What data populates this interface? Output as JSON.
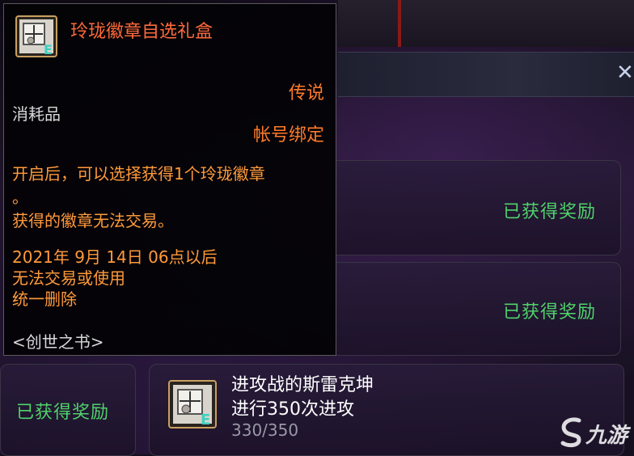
{
  "tooltip": {
    "title": "玲珑徽章自选礼盒",
    "rarity": "传说",
    "type": "消耗品",
    "binding": "帐号绑定",
    "desc_line1": "开启后，可以选择获得1个玲珑徽章",
    "desc_line2": "。",
    "desc_line3": "获得的徽章无法交易。",
    "expire_line1": "2021年 9月 14日 06点以后",
    "expire_line2": "无法交易或使用",
    "expire_line3": "统一删除",
    "series": "<创世之书>",
    "icon_badge": "E"
  },
  "rewards": {
    "row1_label": "已获得奖励",
    "row2_label": "已获得奖励",
    "row3_label": "已获得奖励"
  },
  "quest": {
    "name": "进攻战的斯雷克坤",
    "desc": "进行350次进攻",
    "progress": "330/350",
    "icon_badge": "E"
  },
  "window": {
    "close_symbol": "✕"
  },
  "watermark": {
    "text": "九游"
  },
  "colors": {
    "legendary": "#ff7a2a",
    "reward_green": "#4fd26a",
    "tooltip_title": "#ff6a3a"
  }
}
